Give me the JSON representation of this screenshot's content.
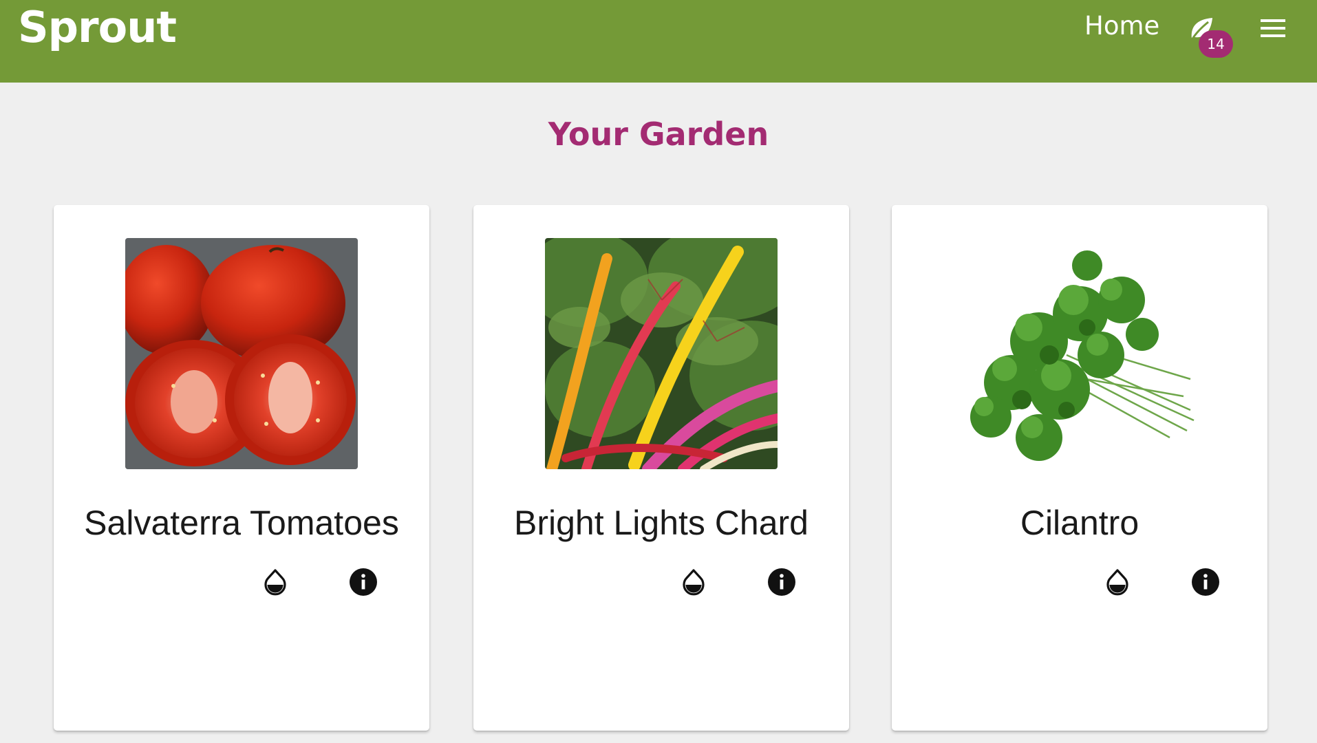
{
  "header": {
    "brand": "Sprout",
    "nav_home": "Home",
    "garden_badge_count": "14",
    "bg_color": "#749a37",
    "accent_color": "#a32b72",
    "icons": {
      "garden": "leaf-icon",
      "menu": "hamburger-menu-icon"
    }
  },
  "main": {
    "title": "Your Garden",
    "cards": [
      {
        "name": "Salvaterra Tomatoes",
        "image": "tomatoes-photo",
        "actions": [
          "water-drop-icon",
          "info-icon"
        ]
      },
      {
        "name": "Bright Lights Chard",
        "image": "chard-photo",
        "actions": [
          "water-drop-icon",
          "info-icon"
        ]
      },
      {
        "name": "Cilantro",
        "image": "cilantro-photo",
        "actions": [
          "water-drop-icon",
          "info-icon"
        ]
      }
    ]
  }
}
